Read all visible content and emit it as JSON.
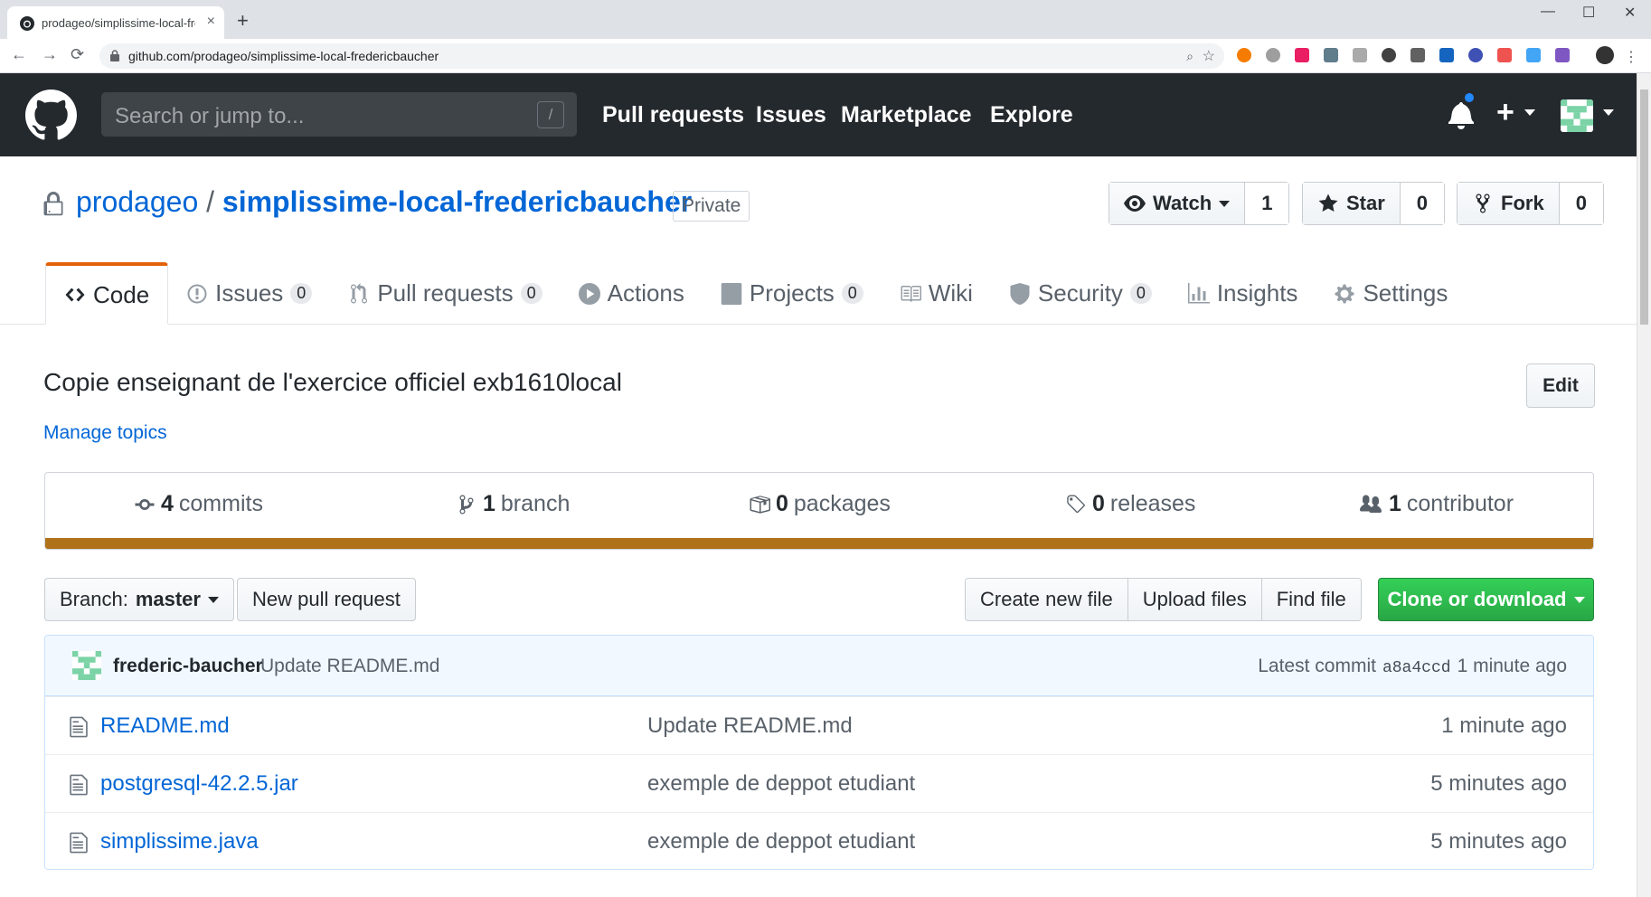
{
  "browser": {
    "tab_title": "prodageo/simplissime-local-frederic",
    "tab_close": "×",
    "new_tab": "+",
    "back": "←",
    "forward": "→",
    "reload": "⟳",
    "url": "github.com/prodageo/simplissime-local-fredericbaucher",
    "window_min": "—",
    "window_max": "☐",
    "window_close": "✕"
  },
  "header": {
    "search_placeholder": "Search or jump to...",
    "search_shortcut": "/",
    "nav": [
      "Pull requests",
      "Issues",
      "Marketplace",
      "Explore"
    ],
    "plus": "+"
  },
  "repo": {
    "owner": "prodageo",
    "separator": "/",
    "name": "simplissime-local-fredericbaucher",
    "visibility": "Private",
    "watch_label": "Watch",
    "watch_count": "1",
    "star_label": "Star",
    "star_count": "0",
    "fork_label": "Fork",
    "fork_count": "0"
  },
  "tabs": [
    {
      "label": "Code",
      "count": null
    },
    {
      "label": "Issues",
      "count": "0"
    },
    {
      "label": "Pull requests",
      "count": "0"
    },
    {
      "label": "Actions",
      "count": null
    },
    {
      "label": "Projects",
      "count": "0"
    },
    {
      "label": "Wiki",
      "count": null
    },
    {
      "label": "Security",
      "count": "0"
    },
    {
      "label": "Insights",
      "count": null
    },
    {
      "label": "Settings",
      "count": null
    }
  ],
  "about": {
    "description": "Copie enseignant de l'exercice officiel exb1610local",
    "edit_label": "Edit",
    "manage_topics": "Manage topics"
  },
  "summary": {
    "commits_num": "4",
    "commits_label": "commits",
    "branch_num": "1",
    "branch_label": "branch",
    "packages_num": "0",
    "packages_label": "packages",
    "releases_num": "0",
    "releases_label": "releases",
    "contributor_num": "1",
    "contributor_label": "contributor",
    "language_color": "#b07219"
  },
  "filenav": {
    "branch_prefix": "Branch:",
    "branch_name": "master",
    "new_pr": "New pull request",
    "create_file": "Create new file",
    "upload": "Upload files",
    "find": "Find file",
    "clone": "Clone or download"
  },
  "commit": {
    "author": "frederic-baucher",
    "message": "Update README.md",
    "latest_label": "Latest commit",
    "sha": "a8a4ccd",
    "age": "1 minute ago"
  },
  "files": [
    {
      "name": "README.md",
      "message": "Update README.md",
      "age": "1 minute ago"
    },
    {
      "name": "postgresql-42.2.5.jar",
      "message": "exemple de deppot etudiant",
      "age": "5 minutes ago"
    },
    {
      "name": "simplissime.java",
      "message": "exemple de deppot etudiant",
      "age": "5 minutes ago"
    }
  ],
  "colors": {
    "header_bg": "#24292e",
    "link": "#0366d6",
    "tab_accent": "#e36209",
    "clone_green": "#28a745",
    "notification_dot": "#2188ff"
  }
}
